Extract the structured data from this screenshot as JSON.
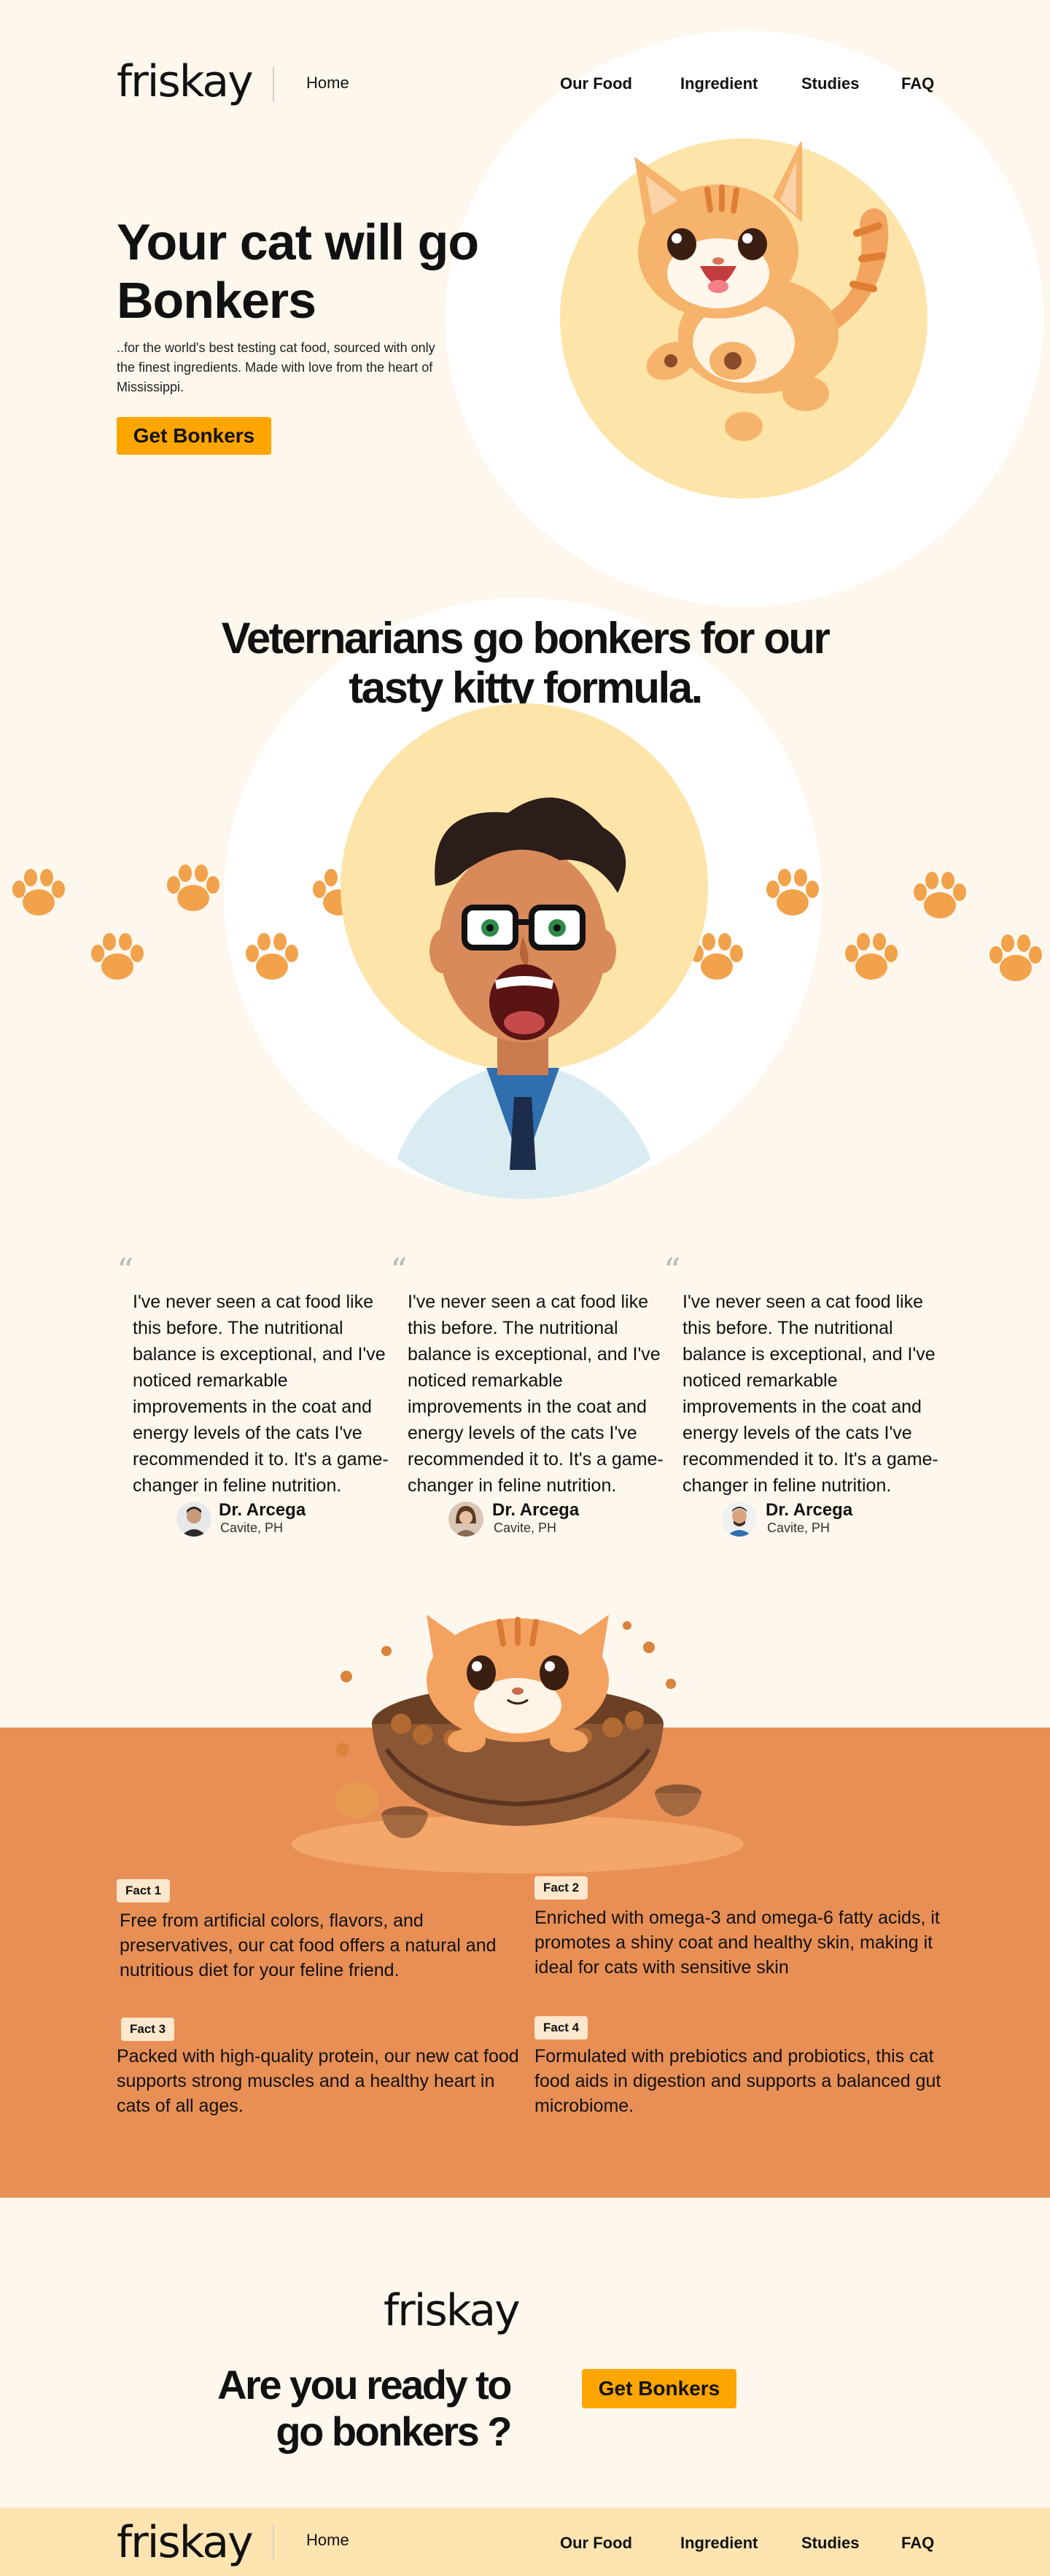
{
  "brand": {
    "logo": "friskay"
  },
  "nav": {
    "home": "Home",
    "links": [
      "Our Food",
      "Ingredient",
      "Studies",
      "FAQ"
    ]
  },
  "hero": {
    "title_line1": "Your cat will go",
    "title_line2": "Bonkers",
    "subtitle": "..for the world's best testing cat food, sourced with only the finest ingredients. Made with love from the heart of Mississippi.",
    "cta": "Get Bonkers"
  },
  "vets": {
    "title_line1": "Veternarians go bonkers for our",
    "title_line2": "tasty kitty formula."
  },
  "testimonials": [
    {
      "quote": "I've never seen a cat food like this before. The nutritional balance is exceptional, and I've noticed remarkable improvements in the coat and energy levels of the cats I've recommended it to. It's a game-changer in feline nutrition.",
      "name": "Dr. Arcega",
      "location": "Cavite, PH"
    },
    {
      "quote": "I've never seen a cat food like this before. The nutritional balance is exceptional, and I've noticed remarkable improvements in the coat and energy levels of the cats I've recommended it to. It's a game-changer in feline nutrition.",
      "name": "Dr. Arcega",
      "location": "Cavite, PH"
    },
    {
      "quote": "I've never seen a cat food like this before. The nutritional balance is exceptional, and I've noticed remarkable improvements in the coat and energy levels of the cats I've recommended it to. It's a game-changer in feline nutrition.",
      "name": "Dr. Arcega",
      "location": "Cavite, PH"
    }
  ],
  "facts": [
    {
      "label": "Fact 1",
      "text": "Free from artificial colors, flavors, and preservatives, our cat food offers a natural and nutritious diet for your feline friend."
    },
    {
      "label": "Fact 2",
      "text": "Enriched with omega-3 and omega-6 fatty acids, it promotes a shiny coat and healthy skin, making it ideal for cats with sensitive skin"
    },
    {
      "label": "Fact 3",
      "text": "Packed with high-quality protein, our new cat food supports strong muscles and a healthy heart in cats of all ages."
    },
    {
      "label": "Fact 4",
      "text": "Formulated with prebiotics and probiotics, this cat food aids in digestion and supports a balanced gut microbiome."
    }
  ],
  "cta_section": {
    "logo": "friskay",
    "title_line1": "Are you ready to",
    "title_line2": "go bonkers ?",
    "button": "Get Bonkers"
  },
  "colors": {
    "background": "#fdf7ed",
    "accent": "#ffa500",
    "facts_bg": "#e88f56",
    "footer_bg": "#fde4b0",
    "circle_yellow": "#fde4a8"
  },
  "icons": [
    "paw-icon",
    "quote-icon"
  ]
}
